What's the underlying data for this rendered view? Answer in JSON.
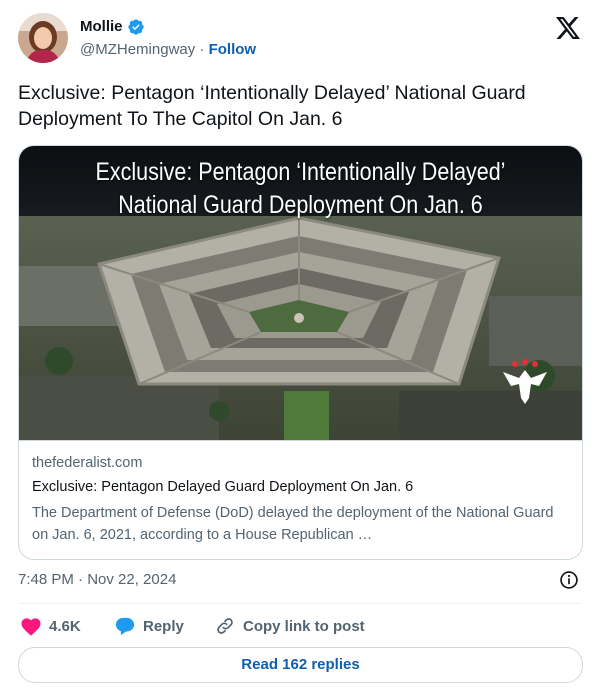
{
  "author": {
    "name": "Mollie",
    "handle": "@MZHemingway",
    "separator": "·",
    "follow_label": "Follow",
    "verified_color": "#1d9bf0",
    "avatar_icon": "profile-photo"
  },
  "tweet": {
    "text": "Exclusive: Pentagon ‘Intentionally Delayed’ National Guard Deployment To The Capitol On Jan. 6",
    "timestamp": "7:48 PM · Nov 22, 2024"
  },
  "card": {
    "image_headline_line1": "Exclusive: Pentagon ‘Intentionally Delayed’",
    "image_headline_line2": "National Guard Deployment On Jan. 6",
    "domain": "thefederalist.com",
    "title": "Exclusive: Pentagon Delayed Guard Deployment On Jan. 6",
    "description": "The Department of Defense (DoD) delayed the deployment of the National Guard on Jan. 6, 2021, according to a House Republican …"
  },
  "actions": {
    "like_count": "4.6K",
    "reply_label": "Reply",
    "copy_label": "Copy link to post",
    "like_color": "#f91880",
    "reply_color": "#1d9bf0"
  },
  "read_replies_label": "Read 162 replies"
}
